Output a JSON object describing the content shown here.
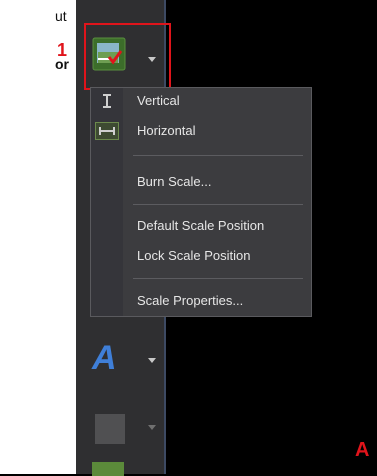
{
  "snippet": {
    "line1": "ut",
    "line2": "or"
  },
  "callouts": {
    "label_1": "1",
    "label_a": "A"
  },
  "scale_button": {
    "icon": "scale-bar-icon"
  },
  "scale_menu": {
    "items": [
      {
        "label": "Vertical",
        "icon": "vertical-scale-icon"
      },
      {
        "label": "Horizontal",
        "icon": "horizontal-scale-icon"
      },
      {
        "label": "Burn Scale..."
      },
      {
        "label": "Default Scale Position"
      },
      {
        "label": "Lock Scale Position"
      },
      {
        "label": "Scale Properties..."
      }
    ]
  },
  "font_button": {
    "glyph": "A"
  },
  "colors": {
    "toolbar": "#2f2f31",
    "menu": "#3c3c3f",
    "callout": "#e0141b",
    "accent_blue": "#3f7fd8"
  }
}
